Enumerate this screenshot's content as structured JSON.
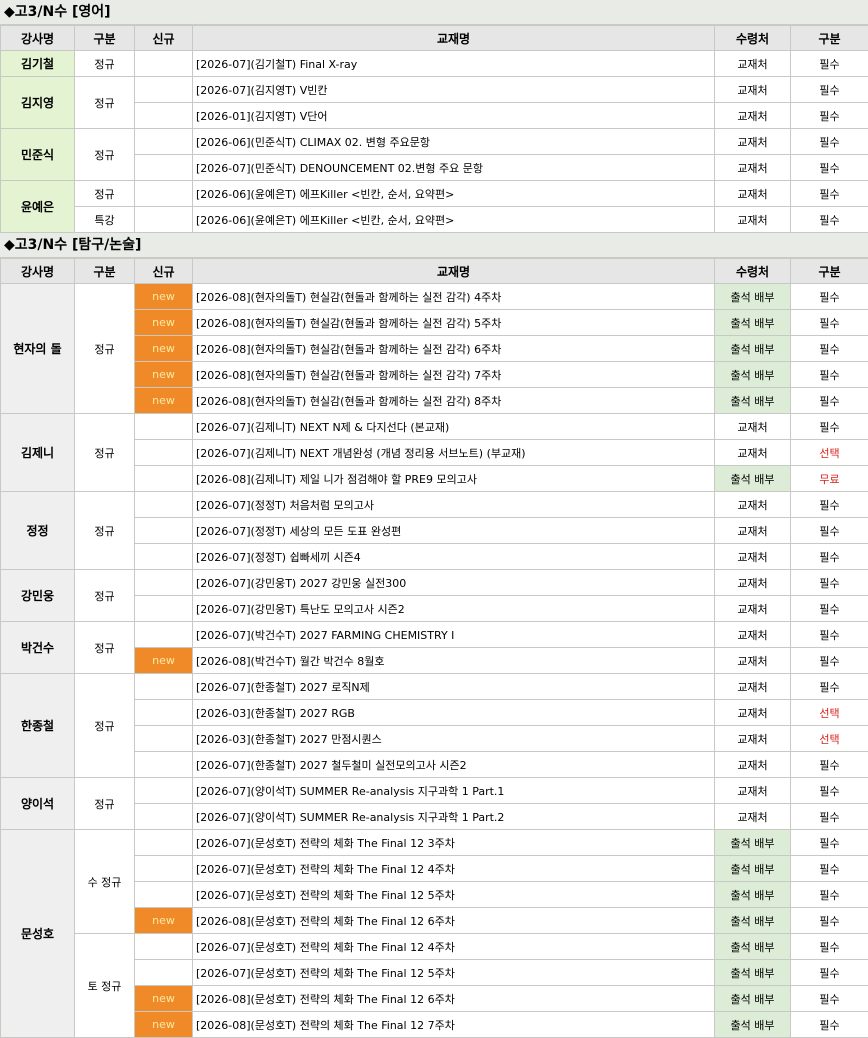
{
  "sections": [
    {
      "title": "◆고3/N수 [영어]",
      "headers": [
        "강사명",
        "구분",
        "신규",
        "교재명",
        "수령처",
        "구분"
      ],
      "groups": [
        {
          "instructor": "김기철",
          "subgroups": [
            {
              "type": "정규",
              "rows": [
                {
                  "new": "",
                  "title": "[2026-07](김기철T) Final X-ray",
                  "receipt": "교재처",
                  "category": "필수"
                }
              ]
            }
          ]
        },
        {
          "instructor": "김지영",
          "subgroups": [
            {
              "type": "정규",
              "rows": [
                {
                  "new": "",
                  "title": "[2026-07](김지영T) V빈칸",
                  "receipt": "교재처",
                  "category": "필수"
                },
                {
                  "new": "",
                  "title": "[2026-01](김지영T) V단어",
                  "receipt": "교재처",
                  "category": "필수"
                }
              ]
            }
          ]
        },
        {
          "instructor": "민준식",
          "subgroups": [
            {
              "type": "정규",
              "rows": [
                {
                  "new": "",
                  "title": "[2026-06](민준식T) CLIMAX 02. 변형 주요문항",
                  "receipt": "교재처",
                  "category": "필수"
                },
                {
                  "new": "",
                  "title": "[2026-07](민준식T) DENOUNCEMENT 02.변형 주요 문항",
                  "receipt": "교재처",
                  "category": "필수"
                }
              ]
            }
          ]
        },
        {
          "instructor": "윤예은",
          "subgroups": [
            {
              "type": "정규",
              "rows": [
                {
                  "new": "",
                  "title": "[2026-06](윤예은T) 에프Killer <빈칸, 순서, 요약편>",
                  "receipt": "교재처",
                  "category": "필수"
                }
              ]
            },
            {
              "type": "특강",
              "rows": [
                {
                  "new": "",
                  "title": "[2026-06](윤예은T) 에프Killer <빈칸, 순서, 요약편>",
                  "receipt": "교재처",
                  "category": "필수"
                }
              ]
            }
          ]
        }
      ]
    },
    {
      "title": "◆고3/N수 [탐구/논술]",
      "headers": [
        "강사명",
        "구분",
        "신규",
        "교재명",
        "수령처",
        "구분"
      ],
      "groups": [
        {
          "instructor": "현자의 돌",
          "subgroups": [
            {
              "type": "정규",
              "rows": [
                {
                  "new": "new",
                  "title": "[2026-08](현자의돌T) 현실감(현돌과 함께하는 실전 감각) 4주차",
                  "receipt": "출석 배부",
                  "category": "필수"
                },
                {
                  "new": "new",
                  "title": "[2026-08](현자의돌T) 현실감(현돌과 함께하는 실전 감각) 5주차",
                  "receipt": "출석 배부",
                  "category": "필수"
                },
                {
                  "new": "new",
                  "title": "[2026-08](현자의돌T) 현실감(현돌과 함께하는 실전 감각) 6주차",
                  "receipt": "출석 배부",
                  "category": "필수"
                },
                {
                  "new": "new",
                  "title": "[2026-08](현자의돌T) 현실감(현돌과 함께하는 실전 감각) 7주차",
                  "receipt": "출석 배부",
                  "category": "필수"
                },
                {
                  "new": "new",
                  "title": "[2026-08](현자의돌T) 현실감(현돌과 함께하는 실전 감각) 8주차",
                  "receipt": "출석 배부",
                  "category": "필수"
                }
              ]
            }
          ]
        },
        {
          "instructor": "김제니",
          "subgroups": [
            {
              "type": "정규",
              "rows": [
                {
                  "new": "",
                  "title": "[2026-07](김제니T) NEXT N제 & 다지선다 (본교재)",
                  "receipt": "교재처",
                  "category": "필수"
                },
                {
                  "new": "",
                  "title": "[2026-07](김제니T) NEXT 개념완성 (개념 정리용 서브노트) (부교재)",
                  "receipt": "교재처",
                  "category": "선택"
                },
                {
                  "new": "",
                  "title": "[2026-08](김제니T) 제일 니가 점검해야 할 PRE9 모의고사",
                  "receipt": "출석 배부",
                  "category": "무료"
                }
              ]
            }
          ]
        },
        {
          "instructor": "정정",
          "subgroups": [
            {
              "type": "정규",
              "rows": [
                {
                  "new": "",
                  "title": "[2026-07](정정T) 처음처럼 모의고사",
                  "receipt": "교재처",
                  "category": "필수"
                },
                {
                  "new": "",
                  "title": "[2026-07](정정T) 세상의 모든 도표 완성편",
                  "receipt": "교재처",
                  "category": "필수"
                },
                {
                  "new": "",
                  "title": "[2026-07](정정T) 쉽빠세끼 시즌4",
                  "receipt": "교재처",
                  "category": "필수"
                }
              ]
            }
          ]
        },
        {
          "instructor": "강민웅",
          "subgroups": [
            {
              "type": "정규",
              "rows": [
                {
                  "new": "",
                  "title": "[2026-07](강민웅T) 2027 강민웅 실전300",
                  "receipt": "교재처",
                  "category": "필수"
                },
                {
                  "new": "",
                  "title": "[2026-07](강민웅T) 특난도 모의고사 시즌2",
                  "receipt": "교재처",
                  "category": "필수"
                }
              ]
            }
          ]
        },
        {
          "instructor": "박건수",
          "subgroups": [
            {
              "type": "정규",
              "rows": [
                {
                  "new": "",
                  "title": "[2026-07](박건수T) 2027 FARMING CHEMISTRY I",
                  "receipt": "교재처",
                  "category": "필수"
                },
                {
                  "new": "new",
                  "title": "[2026-08](박건수T) 월간 박건수 8월호",
                  "receipt": "교재처",
                  "category": "필수"
                }
              ]
            }
          ]
        },
        {
          "instructor": "한종철",
          "subgroups": [
            {
              "type": "정규",
              "rows": [
                {
                  "new": "",
                  "title": "[2026-07](한종철T) 2027 로직N제",
                  "receipt": "교재처",
                  "category": "필수"
                },
                {
                  "new": "",
                  "title": "[2026-03](한종철T) 2027 RGB",
                  "receipt": "교재처",
                  "category": "선택"
                },
                {
                  "new": "",
                  "title": "[2026-03](한종철T) 2027 만점시퀀스",
                  "receipt": "교재처",
                  "category": "선택"
                },
                {
                  "new": "",
                  "title": "[2026-07](한종철T) 2027 철두철미 실전모의고사 시즌2",
                  "receipt": "교재처",
                  "category": "필수"
                }
              ]
            }
          ]
        },
        {
          "instructor": "양이석",
          "subgroups": [
            {
              "type": "정규",
              "rows": [
                {
                  "new": "",
                  "title": "[2026-07](양이석T) SUMMER Re-analysis 지구과학 1 Part.1",
                  "receipt": "교재처",
                  "category": "필수"
                },
                {
                  "new": "",
                  "title": "[2026-07](양이석T) SUMMER Re-analysis 지구과학 1 Part.2",
                  "receipt": "교재처",
                  "category": "필수"
                }
              ]
            }
          ]
        },
        {
          "instructor": "문성호",
          "subgroups": [
            {
              "type": "수 정규",
              "rows": [
                {
                  "new": "",
                  "title": "[2026-07](문성호T) 전략의 체화 The Final 12 3주차",
                  "receipt": "출석 배부",
                  "category": "필수"
                },
                {
                  "new": "",
                  "title": "[2026-07](문성호T) 전략의 체화 The Final 12 4주차",
                  "receipt": "출석 배부",
                  "category": "필수"
                },
                {
                  "new": "",
                  "title": "[2026-07](문성호T) 전략의 체화 The Final 12 5주차",
                  "receipt": "출석 배부",
                  "category": "필수"
                },
                {
                  "new": "new",
                  "title": "[2026-08](문성호T) 전략의 체화 The Final 12 6주차",
                  "receipt": "출석 배부",
                  "category": "필수"
                }
              ]
            },
            {
              "type": "토 정규",
              "rows": [
                {
                  "new": "",
                  "title": "[2026-07](문성호T) 전략의 체화 The Final 12 4주차",
                  "receipt": "출석 배부",
                  "category": "필수"
                },
                {
                  "new": "",
                  "title": "[2026-07](문성호T) 전략의 체화 The Final 12 5주차",
                  "receipt": "출석 배부",
                  "category": "필수"
                },
                {
                  "new": "new",
                  "title": "[2026-08](문성호T) 전략의 체화 The Final 12 6주차",
                  "receipt": "출석 배부",
                  "category": "필수"
                },
                {
                  "new": "new",
                  "title": "[2026-08](문성호T) 전략의 체화 The Final 12 7주차",
                  "receipt": "출석 배부",
                  "category": "필수"
                }
              ]
            }
          ]
        }
      ]
    }
  ]
}
